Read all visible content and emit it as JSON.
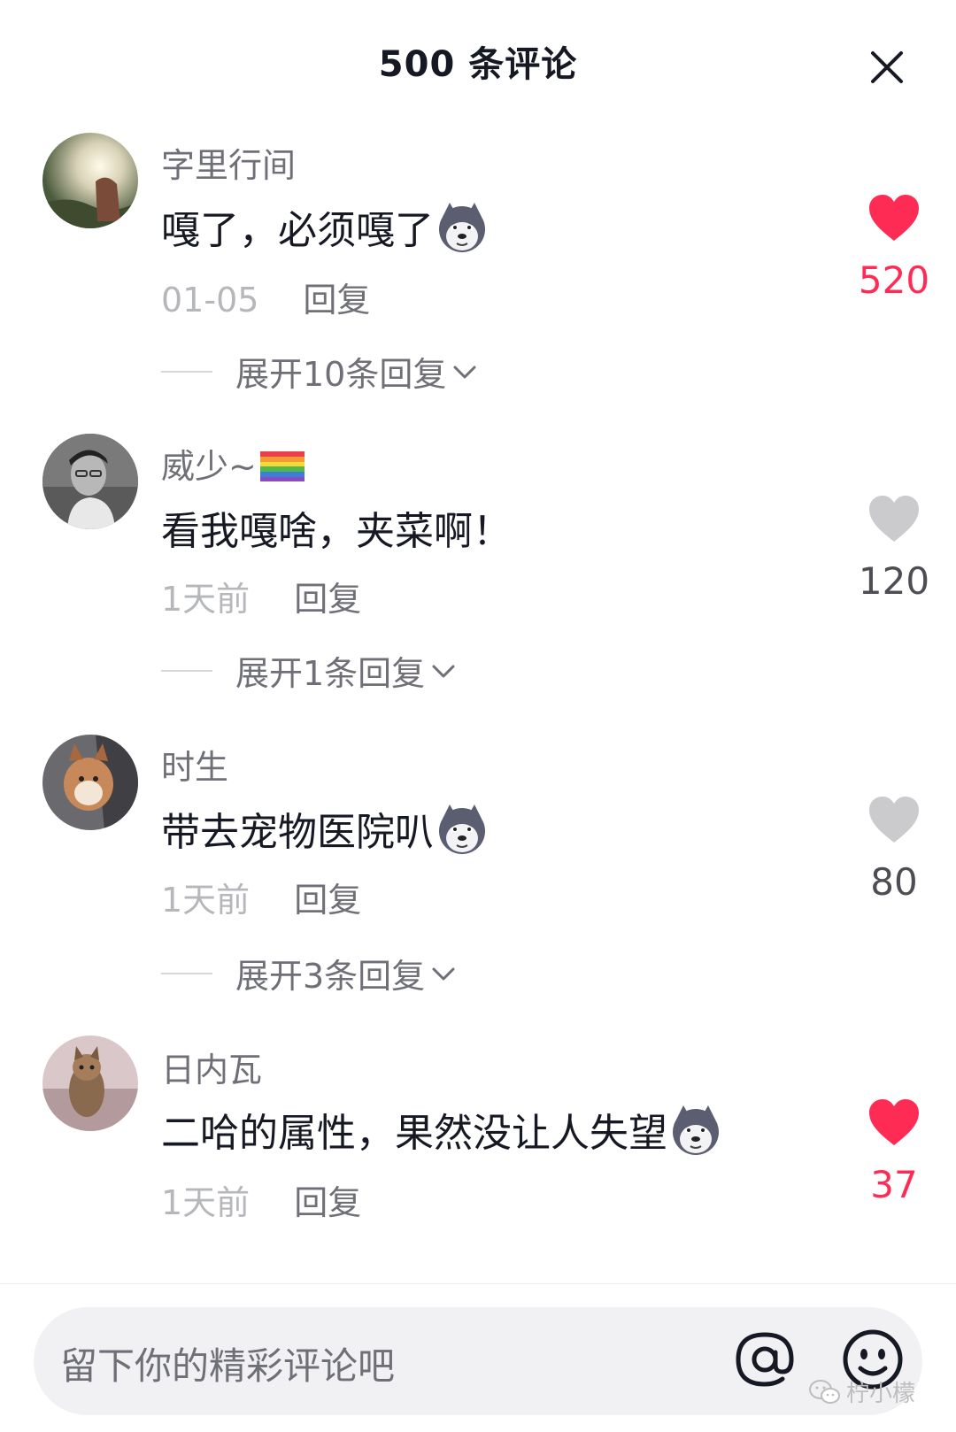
{
  "header": {
    "title": "500 条评论",
    "close_icon": "close-icon"
  },
  "comments": [
    {
      "username": "字里行间",
      "text": "嘎了，必须嘎了",
      "emoji": "husky-dog-emoji",
      "time": "01-05",
      "reply_label": "回复",
      "expand_label": "展开10条回复",
      "likes": "520",
      "liked": true
    },
    {
      "username": "威少~",
      "username_icon": "rainbow-flag-emoji",
      "text": "看我嘎啥，夹菜啊！",
      "time": "1天前",
      "reply_label": "回复",
      "expand_label": "展开1条回复",
      "likes": "120",
      "liked": false
    },
    {
      "username": "时生",
      "text": "带去宠物医院叭",
      "emoji": "husky-dog-emoji",
      "time": "1天前",
      "reply_label": "回复",
      "expand_label": "展开3条回复",
      "likes": "80",
      "liked": false
    },
    {
      "username": "日内瓦",
      "text": "二哈的属性，果然没让人失望",
      "emoji": "husky-dog-emoji",
      "time": "1天前",
      "reply_label": "回复",
      "likes": "37",
      "liked": true
    }
  ],
  "input": {
    "placeholder": "留下你的精彩评论吧",
    "at_icon": "at-icon",
    "emoji_icon": "smile-icon"
  },
  "watermark": {
    "text": "柠小檬",
    "icon": "wechat-icon"
  },
  "colors": {
    "accent": "#fe2c55",
    "muted": "#b6b7bb",
    "secondary": "#6f7077",
    "primary_text": "#161823"
  }
}
